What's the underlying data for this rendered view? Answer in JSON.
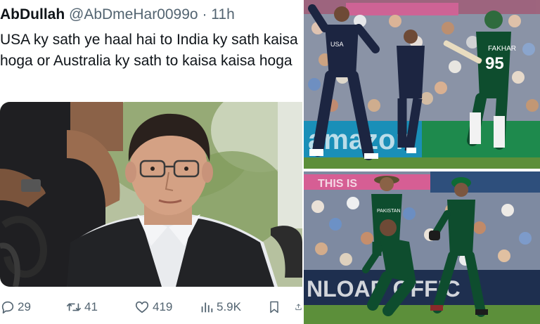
{
  "tweet": {
    "display_name": "AbDullah",
    "handle": "@AbDmeHar0099o",
    "separator": "·",
    "time": "11h",
    "text": "USA ky sath ye haal hai to India ky sath kaisa hoga or Australia ky sath to kaisa kaisa hoga",
    "actions": {
      "replies": "29",
      "reposts": "41",
      "likes": "419",
      "views": "5.9K"
    }
  },
  "collage": {
    "top_photo": {
      "boundary_text": "amazon",
      "shirt_text_left": "USA",
      "jersey_name": "FAKHAR",
      "jersey_number": "95"
    },
    "bottom_photo": {
      "stand_banner": "THIS IS",
      "boundary_text": "NLOAD   OFFIC",
      "shirt_text": "PAKISTAN"
    }
  },
  "colors": {
    "text_primary": "#0f1419",
    "text_secondary": "#536471",
    "pakistan_green": "#0e4d2e",
    "usa_navy": "#1c2541",
    "pitch_green": "#5c8f3a"
  },
  "icons": [
    "reply-icon",
    "repost-icon",
    "like-icon",
    "views-icon",
    "bookmark-icon",
    "share-icon"
  ]
}
